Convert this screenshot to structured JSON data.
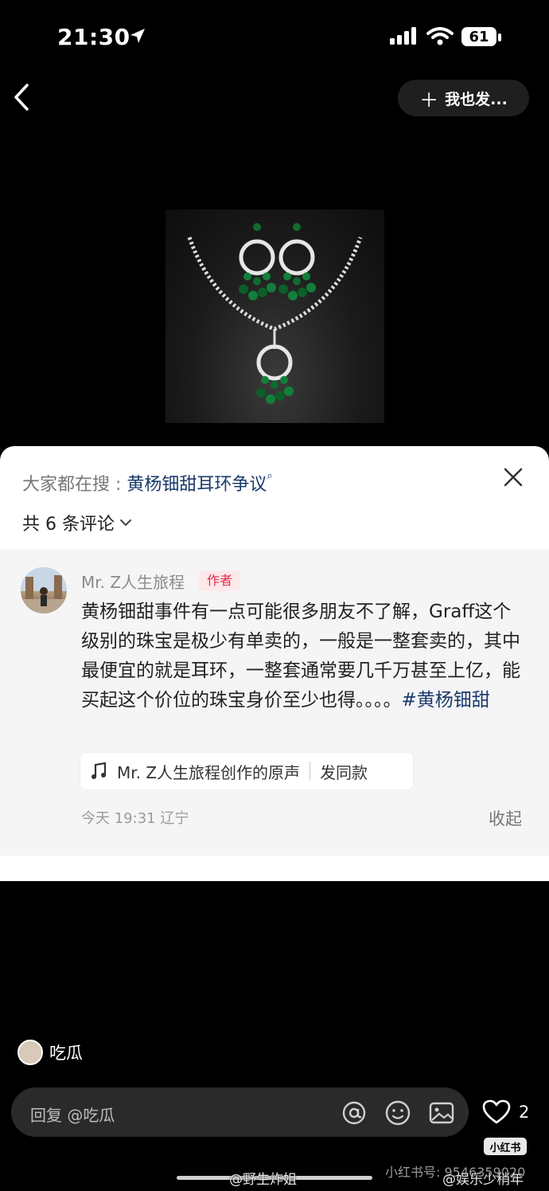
{
  "status": {
    "time": "21:30",
    "battery": "61"
  },
  "header": {
    "post_label": "我也发..."
  },
  "sheet": {
    "search_prefix": "大家都在搜 : ",
    "search_keyword": "黄杨钿甜耳环争议",
    "comment_count": "共 6 条评论",
    "comment": {
      "author": "Mr. Z人生旅程",
      "author_tag": "作者",
      "text": "黄杨钿甜事件有一点可能很多朋友不了解，Graff这个级别的珠宝是极少有单卖的，一般是一整套卖的，其中最便宜的就是耳环，一整套通常要几千万甚至上亿，能买起这个价位的珠宝身价至少也得。。。。",
      "hashtag": "#黄杨钿甜",
      "sound_label": "Mr. Z人生旅程创作的原声",
      "sound_action": "发同款",
      "time": "今天 19:31",
      "location": "辽宁",
      "collapse": "收起"
    }
  },
  "viewer": {
    "name": "吃瓜"
  },
  "input": {
    "placeholder": "回复 @吃瓜"
  },
  "actions": {
    "like_count": "2"
  },
  "badge": "小红书",
  "watermarks": {
    "weibo_left": "@野生炸姐",
    "xhs_id": "小红书号: 9546359020",
    "weibo_right": "@娱乐少稍年"
  },
  "icons": [
    "location-arrow-icon",
    "signal-icon",
    "wifi-icon",
    "back-icon",
    "plus-icon",
    "close-icon",
    "chevron-down-icon",
    "music-note-icon",
    "at-icon",
    "emoji-icon",
    "image-icon",
    "heart-icon"
  ]
}
